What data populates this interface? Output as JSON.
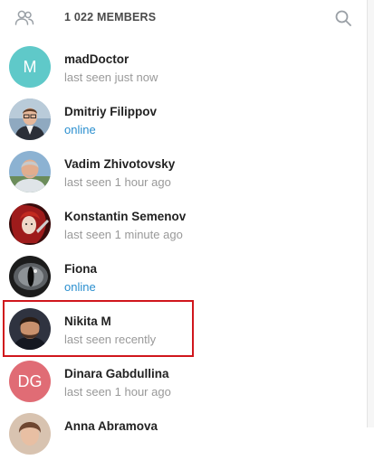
{
  "header": {
    "members_label": "1 022 MEMBERS",
    "people_icon": "people-icon",
    "search_icon": "search-icon"
  },
  "members": [
    {
      "name": "madDoctor",
      "status": "last seen just now",
      "online": false,
      "initials": "M",
      "avatar_color": "#5fc9c9"
    },
    {
      "name": "Dmitriy Filippov",
      "status": "online",
      "online": true,
      "initials": "",
      "avatar_color": "#6a8aa8"
    },
    {
      "name": "Vadim Zhivotovsky",
      "status": "last seen 1 hour ago",
      "online": false,
      "initials": "",
      "avatar_color": "#7ca4c4"
    },
    {
      "name": "Konstantin Semenov",
      "status": "last seen 1 minute ago",
      "online": false,
      "initials": "",
      "avatar_color": "#8a1c1c"
    },
    {
      "name": "Fiona",
      "status": "online",
      "online": true,
      "initials": "",
      "avatar_color": "#2e2e2e"
    },
    {
      "name": "Nikita M",
      "status": "last seen recently",
      "online": false,
      "initials": "",
      "avatar_color": "#3c3f4a"
    },
    {
      "name": "Dinara Gabdullina",
      "status": "last seen 1 hour ago",
      "online": false,
      "initials": "DG",
      "avatar_color": "#e06c75"
    },
    {
      "name": "Anna Abramova",
      "status": "",
      "online": false,
      "initials": "",
      "avatar_color": "#b07a5a"
    }
  ],
  "highlight_color": "#d0161c",
  "accent_color": "#2a8fcf"
}
